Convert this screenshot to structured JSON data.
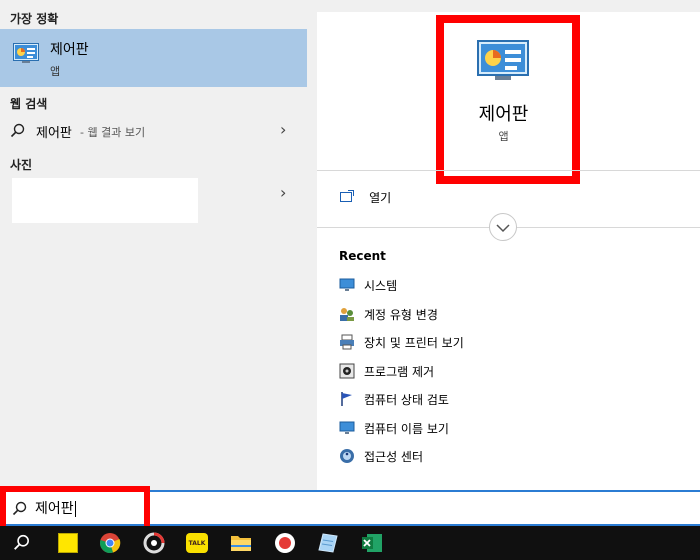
{
  "left": {
    "best_match_title": "가장 정확",
    "best_match": {
      "name": "제어판",
      "type": "앱"
    },
    "web_title": "웹 검색",
    "web": {
      "query": "제어판",
      "suffix": "- 웹 결과 보기"
    },
    "photos_title": "사진"
  },
  "right": {
    "app_name": "제어판",
    "app_type": "앱",
    "open_label": "열기",
    "recent_title": "Recent",
    "recent": [
      {
        "label": "시스템",
        "icon": "monitor-icon"
      },
      {
        "label": "계정 유형 변경",
        "icon": "users-icon"
      },
      {
        "label": "장치 및 프린터 보기",
        "icon": "printer-icon"
      },
      {
        "label": "프로그램 제거",
        "icon": "program-icon"
      },
      {
        "label": "컴퓨터 상태 검토",
        "icon": "flag-icon"
      },
      {
        "label": "컴퓨터 이름 보기",
        "icon": "monitor-icon"
      },
      {
        "label": "접근성 센터",
        "icon": "accessibility-icon"
      }
    ]
  },
  "search": {
    "value": "제어판"
  },
  "colors": {
    "selection": "#a9c8e6",
    "highlight_red": "#ff0000",
    "accent_blue": "#2b7cd3"
  }
}
